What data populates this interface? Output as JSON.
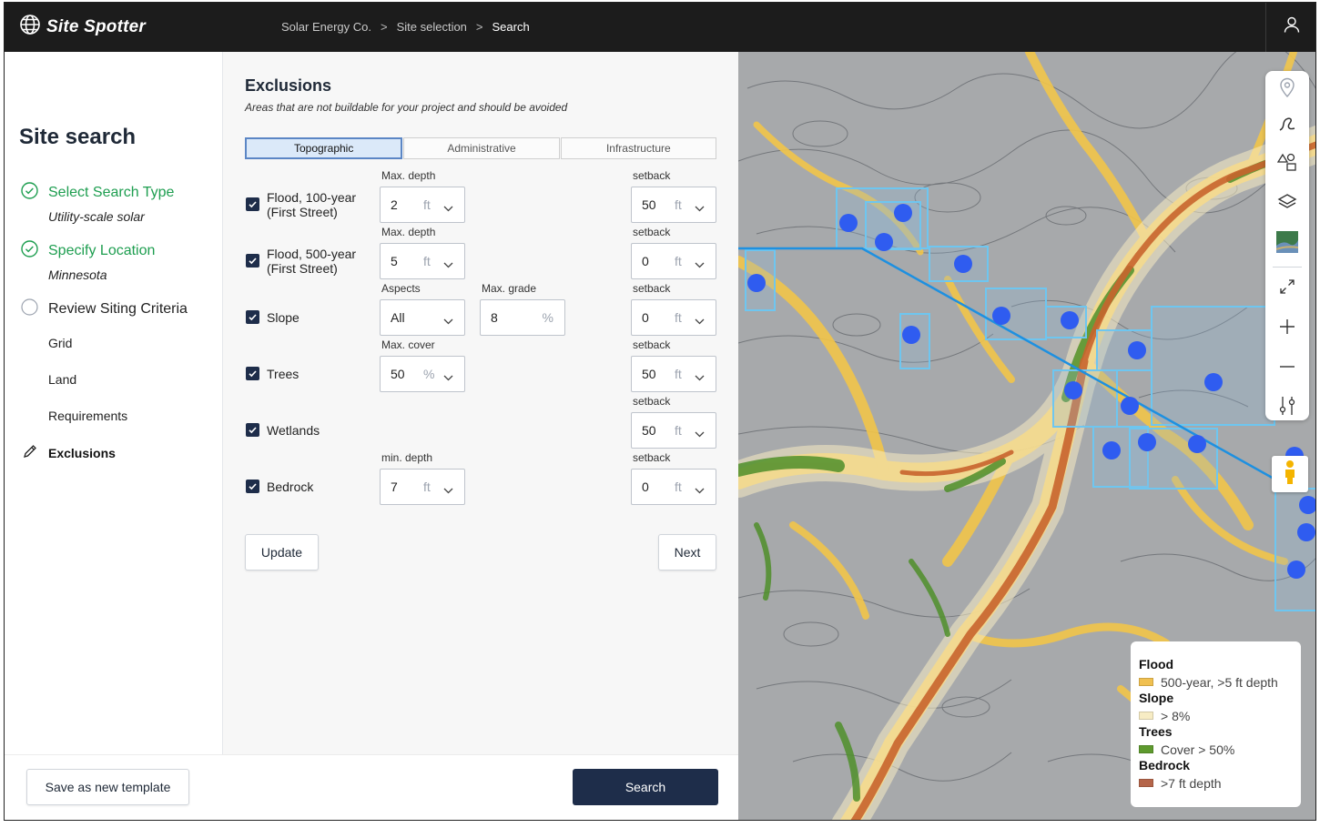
{
  "app": {
    "brand": "Site Spotter"
  },
  "breadcrumbs": [
    "Solar Energy Co.",
    "Site selection",
    "Search"
  ],
  "sidebar": {
    "title": "Site search",
    "steps": [
      {
        "label": "Select Search Type",
        "sub": "Utility-scale solar",
        "status": "done"
      },
      {
        "label": "Specify Location",
        "sub": "Minnesota",
        "status": "done"
      },
      {
        "label": "Review Siting Criteria",
        "status": "pending"
      }
    ],
    "substeps": [
      "Grid",
      "Land",
      "Requirements"
    ],
    "current": "Exclusions"
  },
  "footer": {
    "save_template": "Save as new template",
    "search": "Search"
  },
  "exclusions": {
    "title": "Exclusions",
    "description": "Areas that are not buildable for your project and should be avoided",
    "tabs": [
      "Topographic",
      "Administrative",
      "Infrastructure"
    ],
    "active_tab": "Topographic",
    "setback_label": "setback",
    "rows": [
      {
        "label": "Flood, 100-year\n(First Street)",
        "checked": true,
        "f1_label": "Max. depth",
        "f1_value": "2",
        "f1_unit": "ft",
        "setback": "50",
        "setback_unit": "ft"
      },
      {
        "label": "Flood, 500-year\n(First Street)",
        "checked": true,
        "f1_label": "Max. depth",
        "f1_value": "5",
        "f1_unit": "ft",
        "setback": "0",
        "setback_unit": "ft"
      },
      {
        "label": "Slope",
        "checked": true,
        "f1_label": "Aspects",
        "f1_value": "All",
        "f2_label": "Max. grade",
        "f2_value": "8",
        "f2_unit": "%",
        "setback": "0",
        "setback_unit": "ft"
      },
      {
        "label": "Trees",
        "checked": true,
        "f1_label": "Max. cover",
        "f1_value": "50",
        "f1_unit": "%",
        "setback": "50",
        "setback_unit": "ft"
      },
      {
        "label": "Wetlands",
        "checked": true,
        "setback": "50",
        "setback_unit": "ft"
      },
      {
        "label": "Bedrock",
        "checked": true,
        "f1_label": "min. depth",
        "f1_value": "7",
        "f1_unit": "ft",
        "setback": "0",
        "setback_unit": "ft"
      }
    ],
    "update_button": "Update",
    "next_button": "Next"
  },
  "map": {
    "toolbar_icons": [
      "map-pin-icon",
      "draw-line-icon",
      "shapes-icon",
      "layers-icon",
      "terrain-thumbnail",
      "expand-icon",
      "zoom-in-icon",
      "zoom-out-icon",
      "filter-sliders-icon"
    ],
    "legend": [
      {
        "heading": "Flood",
        "item": "500-year, >5 ft depth",
        "color": "#f0c050"
      },
      {
        "heading": "Slope",
        "item": "> 8%",
        "color": "#f7ecc4"
      },
      {
        "heading": "Trees",
        "item": "Cover > 50%",
        "color": "#5e9a2e"
      },
      {
        "heading": "Bedrock",
        "item": ">7 ft depth",
        "color": "#b5654a"
      }
    ]
  },
  "colors": {
    "navy": "#1e2d4a",
    "green": "#1e9e50",
    "tab_active": "#dbe9f9",
    "parcel": "#6ec6f0",
    "site_dot": "#2f5cf0"
  }
}
